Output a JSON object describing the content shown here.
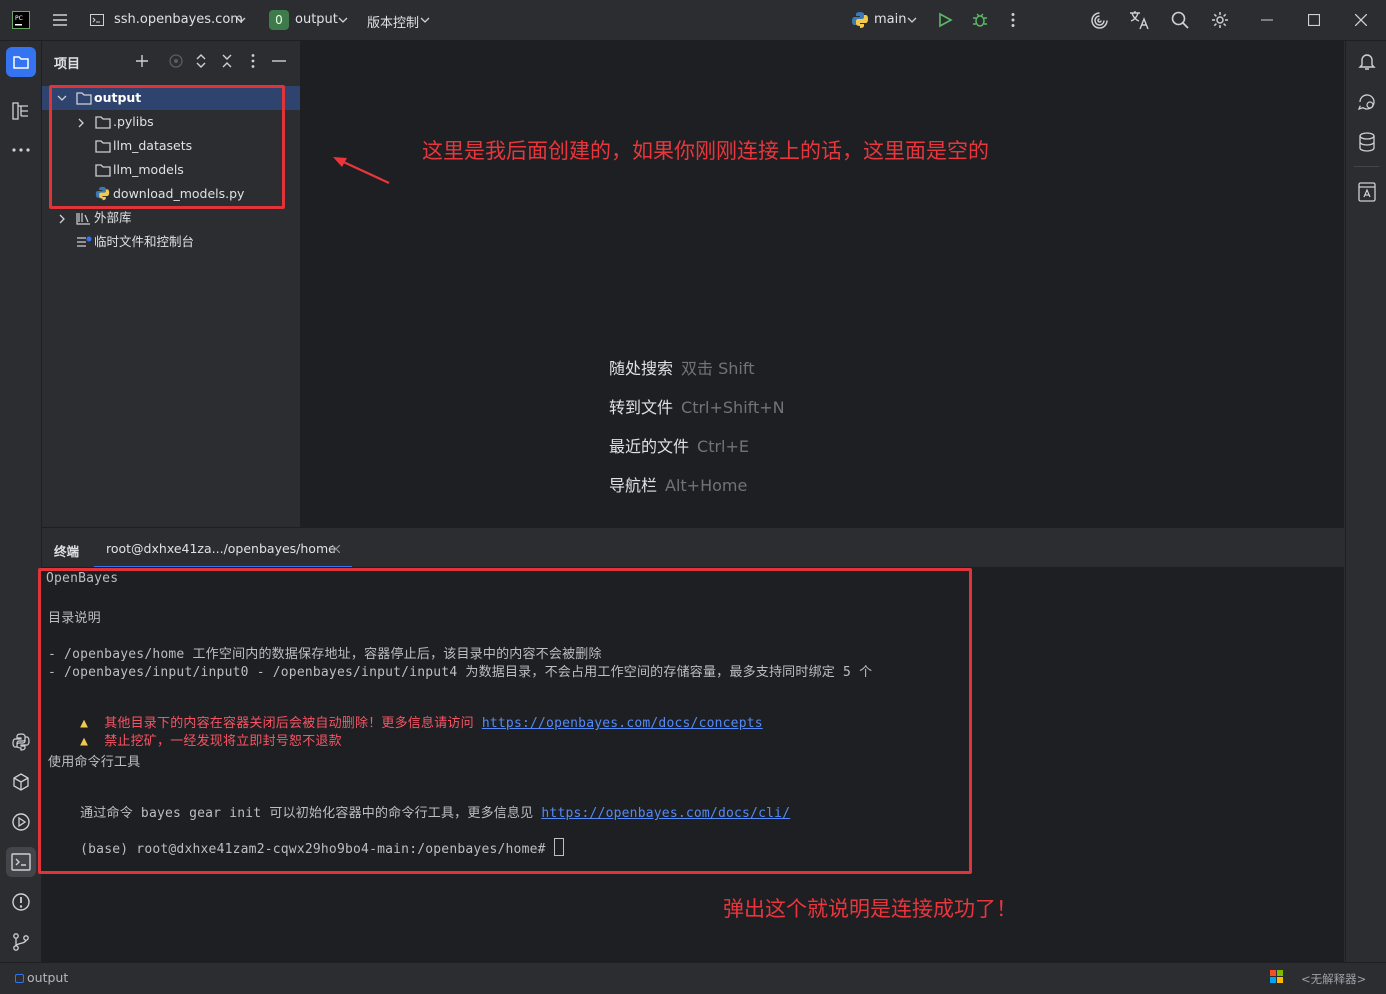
{
  "titlebar": {
    "remote": "ssh.openbayes.com",
    "project_badge": "0",
    "project": "output",
    "vcs": "版本控制",
    "run_config": "main"
  },
  "project_panel": {
    "title": "项目",
    "tree": [
      {
        "label": "output",
        "type": "folder",
        "expanded": true,
        "selected": true
      },
      {
        "label": ".pylibs",
        "type": "folder",
        "expanded": false
      },
      {
        "label": "llm_datasets",
        "type": "folder"
      },
      {
        "label": "llm_models",
        "type": "folder"
      },
      {
        "label": "download_models.py",
        "type": "python-file"
      },
      {
        "label": "外部库",
        "type": "library",
        "expanded": false
      },
      {
        "label": "临时文件和控制台",
        "type": "scratches"
      }
    ]
  },
  "editor": {
    "hints": [
      {
        "action": "随处搜索",
        "keys": "双击 Shift"
      },
      {
        "action": "转到文件",
        "keys": "Ctrl+Shift+N"
      },
      {
        "action": "最近的文件",
        "keys": "Ctrl+E"
      },
      {
        "action": "导航栏",
        "keys": "Alt+Home"
      }
    ]
  },
  "terminal": {
    "panel_title": "终端",
    "tab_label": "root@dxhxe41za.../openbayes/home",
    "lines": {
      "brand": "OpenBayes",
      "dir_heading": "目录说明",
      "home_line": "- /openbayes/home 工作空间内的数据保存地址，容器停止后，该目录中的内容不会被删除",
      "input_line": "- /openbayes/input/input0 - /openbayes/input/input4 为数据目录，不会占用工作空间的存储容量，最多支持同时绑定 5 个",
      "warn1_text": "其他目录下的内容在容器关闭后会被自动删除！更多信息请访问 ",
      "warn1_link": "https://openbayes.com/docs/concepts",
      "warn2_text": "禁止挖矿，一经发现将立即封号恕不退款",
      "cli_heading": "使用命令行工具",
      "cli_text": "通过命令 bayes gear init 可以初始化容器中的命令行工具，更多信息见 ",
      "cli_link": "https://openbayes.com/docs/cli/",
      "prompt": "(base) root@dxhxe41zam2-cqwx29ho9bo4-main:/openbayes/home# "
    }
  },
  "annotations": {
    "top": "这里是我后面创建的，如果你刚刚连接上的话，这里面是空的",
    "bottom": "弹出这个就说明是连接成功了！"
  },
  "statusbar": {
    "left": "output",
    "interpreter": "<无解释器>"
  },
  "colors": {
    "accent": "#3574f0",
    "annotation_red": "#e8363c",
    "warning_red": "#f75464",
    "link": "#548af7",
    "green": "#5fb865"
  }
}
